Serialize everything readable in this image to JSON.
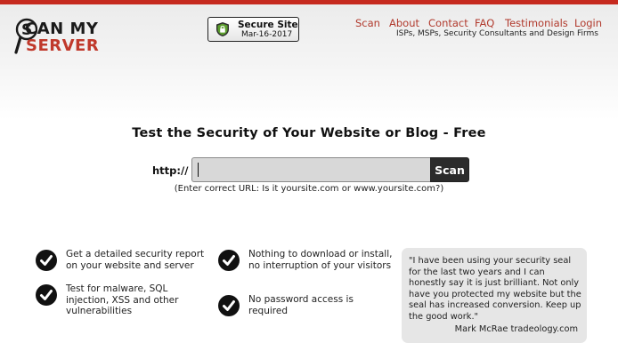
{
  "logo": {
    "line1": "CAN MY",
    "line2": "SERVER"
  },
  "badge": {
    "title": "Secure Site",
    "date": "Mar-16-2017"
  },
  "nav": {
    "items": [
      "Scan",
      "About",
      "Contact",
      "FAQ",
      "Testimonials",
      "Login"
    ],
    "tagline": "ISPs, MSPs, Security Consultants and Design Firms"
  },
  "main": {
    "headline": "Test the Security of Your Website or Blog - Free",
    "prefix": "http://",
    "url_value": "",
    "scan_label": "Scan",
    "hint": "(Enter correct URL: Is it yoursite.com or www.yoursite.com?)"
  },
  "features": [
    "Get a detailed security report on your website and server",
    "Test for malware, SQL injection, XSS and other vulnerabilities",
    "Nothing to download or install, no interruption of your visitors",
    "No password access is required"
  ],
  "testimonial": {
    "quote": "\"I have been using your security seal for the last two years and I can honestly say it is just brilliant. Not only have you protected my website but the seal has increased conversion. Keep up the good work.\"",
    "author": "Mark McRae tradeology.com"
  },
  "colors": {
    "accent": "#c62a1f",
    "nav_link": "#b1392c",
    "button": "#2b2b2b"
  }
}
